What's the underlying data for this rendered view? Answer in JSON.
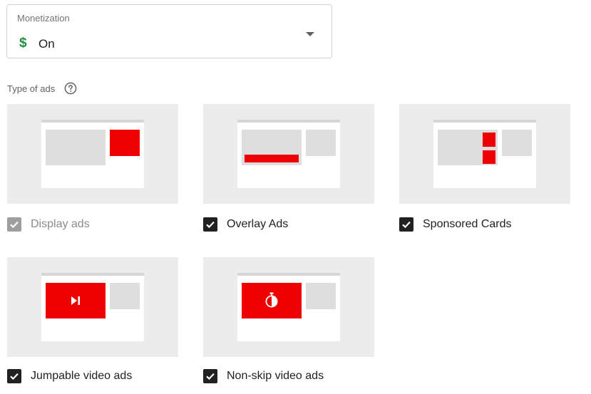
{
  "monetization": {
    "label": "Monetization",
    "currency_symbol": "$",
    "value": "On"
  },
  "ad_types": {
    "title": "Type of ads",
    "options": [
      {
        "label": "Display ads",
        "checked": true,
        "disabled": true
      },
      {
        "label": "Overlay Ads",
        "checked": true,
        "disabled": false
      },
      {
        "label": "Sponsored Cards",
        "checked": true,
        "disabled": false
      },
      {
        "label": "Jumpable video ads",
        "checked": true,
        "disabled": false
      },
      {
        "label": "Non-skip video ads",
        "checked": true,
        "disabled": false
      }
    ]
  },
  "colors": {
    "accent_red": "#ee0000",
    "money_green": "#1e8e3e",
    "checkbox_checked": "#212121",
    "checkbox_disabled": "#9e9e9e"
  },
  "icons": {
    "dropdown": "chevron-down-icon",
    "help": "help-icon",
    "checkbox": "checkmark-icon",
    "jumpable": "skip-next-icon",
    "nonskip": "stopwatch-icon"
  }
}
